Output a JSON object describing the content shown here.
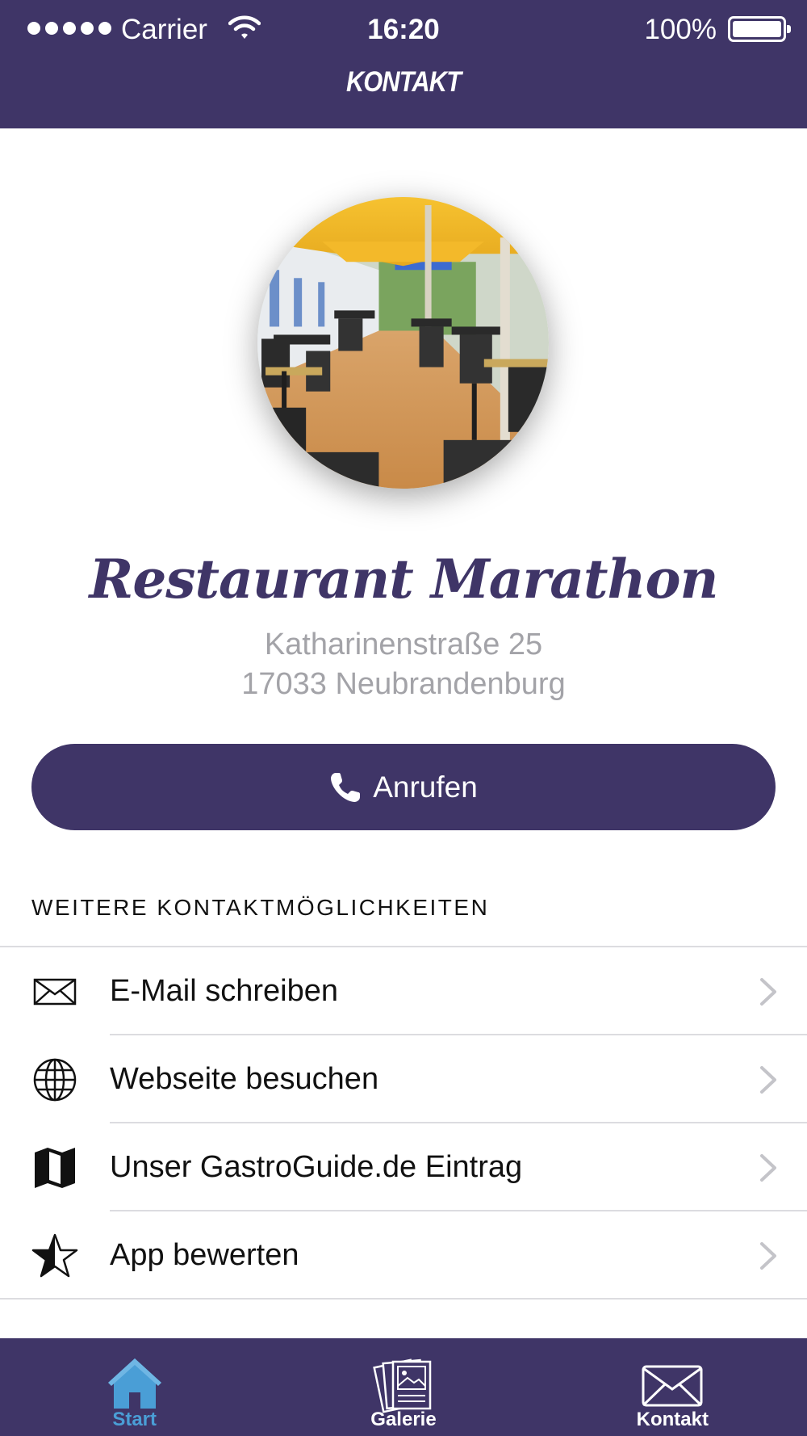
{
  "status_bar": {
    "carrier": "Carrier",
    "time": "16:20",
    "battery": "100%",
    "signal_bars": 5
  },
  "nav": {
    "title": "KONTAKT"
  },
  "restaurant": {
    "name": "Restaurant Marathon",
    "address_line1": "Katharinenstraße 25",
    "address_line2": "17033 Neubrandenburg"
  },
  "call_button": {
    "label": "Anrufen",
    "icon": "phone-icon"
  },
  "section": {
    "title": "WEITERE KONTAKTMÖGLICHKEITEN"
  },
  "contact_items": [
    {
      "label": "E-Mail schreiben",
      "icon": "envelope-icon"
    },
    {
      "label": "Webseite besuchen",
      "icon": "globe-icon"
    },
    {
      "label": "Unser GastroGuide.de Eintrag",
      "icon": "map-icon"
    },
    {
      "label": "App bewerten",
      "icon": "star-icon"
    }
  ],
  "tabbar": {
    "tabs": [
      {
        "label": "Start",
        "icon": "home-icon",
        "active": true
      },
      {
        "label": "Galerie",
        "icon": "gallery-icon",
        "active": false
      },
      {
        "label": "Kontakt",
        "icon": "mail-icon",
        "active": false
      }
    ]
  },
  "colors": {
    "brand": "#3f3567",
    "active_tab": "#4a9ed6",
    "secondary_text": "#a3a3a8"
  }
}
